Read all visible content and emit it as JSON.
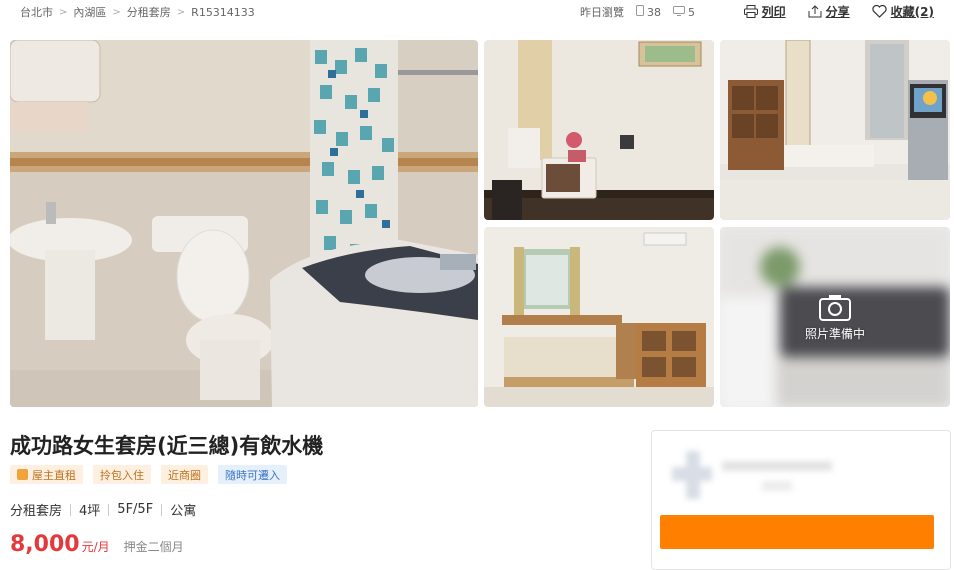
{
  "breadcrumb": [
    "台北市",
    "內湖區",
    "分租套房",
    "R15314133"
  ],
  "stats": {
    "viewed_label": "昨日瀏覽",
    "views": "38",
    "comments": "5"
  },
  "actions": {
    "print": "列印",
    "share": "分享",
    "favorite": "收藏(2)"
  },
  "photo_placeholder": "照片準備中",
  "title": "成功路女生套房(近三總)有飲水機",
  "tags": [
    "屋主直租",
    "拎包入住",
    "近商圈",
    "隨時可遷入"
  ],
  "specs": [
    "分租套房",
    "4坪",
    "5F/5F",
    "公寓"
  ],
  "price": {
    "value": "8,000",
    "unit": "元/月",
    "deposit": "押金二個月"
  },
  "colors": {
    "accent": "#ff8000",
    "price": "#e4393c"
  }
}
